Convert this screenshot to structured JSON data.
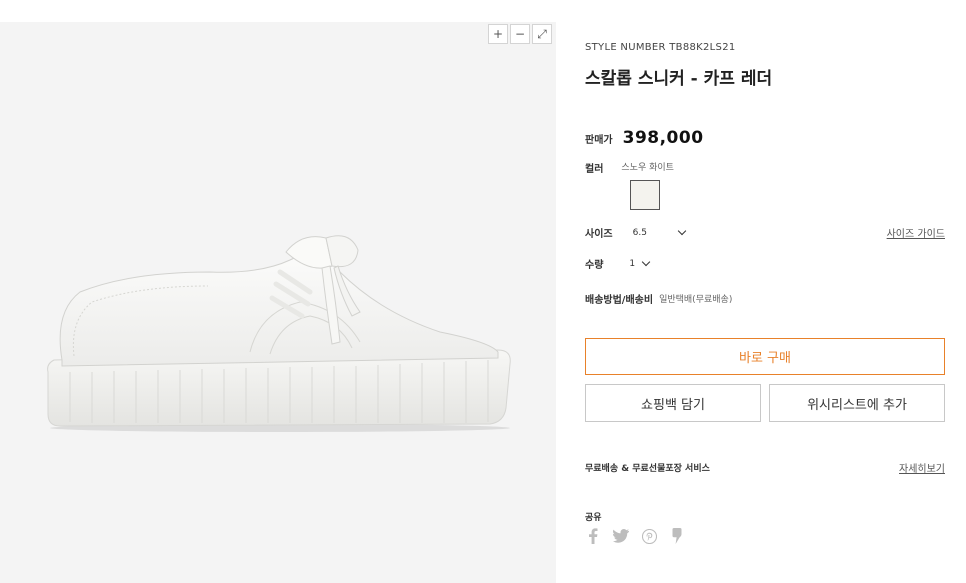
{
  "gallery": {
    "zoom_in": "+",
    "zoom_out": "−",
    "fullscreen": "⤢"
  },
  "product": {
    "style_number": "STYLE NUMBER TB88K2LS21",
    "title": "스칼롭 스니커 - 카프 레더",
    "price_label": "판매가",
    "price": "398,000",
    "color_label": "컬러",
    "color_name": "스노우 화이트",
    "swatch_color": "#f4f3ee",
    "size_label": "사이즈",
    "size_value": "6.5",
    "size_guide": "사이즈 가이드",
    "qty_label": "수량",
    "qty_value": "1",
    "shipping_label": "배송방법/배송비",
    "shipping_value": "일반택배(무료배송)"
  },
  "actions": {
    "buy_now": "바로 구매",
    "add_to_bag": "쇼핑백 담기",
    "add_to_wishlist": "위시리스트에 추가"
  },
  "service": {
    "label": "무료배송 & 무료선물포장 서비스",
    "link": "자세히보기"
  },
  "share": {
    "label": "공유",
    "icons": [
      "facebook-icon",
      "twitter-icon",
      "pinterest-icon",
      "kakaostory-icon"
    ]
  },
  "colors": {
    "accent": "#e8812a",
    "gallery_bg": "#f4f4f4"
  }
}
